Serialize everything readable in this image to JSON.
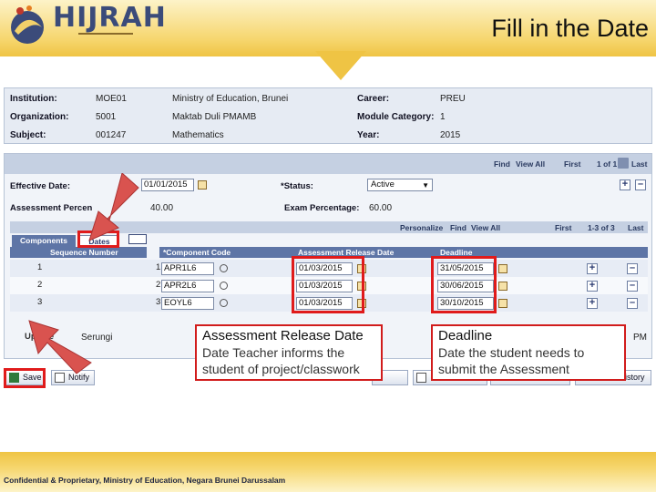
{
  "header": {
    "brand": "HIJRAH",
    "slide_title": "Fill in the Date"
  },
  "info": {
    "institution_label": "Institution:",
    "institution_code": "MOE01",
    "institution_name": "Ministry of Education, Brunei",
    "organization_label": "Organization:",
    "organization_code": "5001",
    "organization_name": "Maktab Duli PMAMB",
    "subject_label": "Subject:",
    "subject_code": "001247",
    "subject_name": "Mathematics",
    "career_label": "Career:",
    "career_value": "PREU",
    "module_category_label": "Module Category:",
    "module_category_value": "1",
    "year_label": "Year:",
    "year_value": "2015"
  },
  "panel": {
    "nav_find": "Find",
    "nav_view_all": "View All",
    "nav_first": "First",
    "nav_count": "1 of 1",
    "nav_last": "Last",
    "effective_date_label": "Effective Date:",
    "effective_date_value": "01/01/2015",
    "status_label": "*Status:",
    "status_value": "Active",
    "assessment_percent_label": "Assessment Percen",
    "assessment_percent_value": "40.00",
    "exam_percentage_label": "Exam Percentage:",
    "exam_percentage_value": "60.00",
    "grid_personalize": "Personalize",
    "grid_find": "Find",
    "grid_view_all": "View All",
    "grid_first": "First",
    "grid_count": "1-3 of 3",
    "grid_last": "Last",
    "tabs": [
      {
        "label": "Components"
      },
      {
        "label": "Dates"
      }
    ],
    "columns": {
      "sequence": "Sequence Number",
      "component": "*Component Code",
      "release": "Assessment Release Date",
      "deadline": "Deadline"
    },
    "rows": [
      {
        "row": "1",
        "seq": "1",
        "code": "APR1L6",
        "release": "01/03/2015",
        "deadline": "31/05/2015"
      },
      {
        "row": "2",
        "seq": "2",
        "code": "APR2L6",
        "release": "01/03/2015",
        "deadline": "30/06/2015"
      },
      {
        "row": "3",
        "seq": "3",
        "code": "EOYL6",
        "release": "01/03/2015",
        "deadline": "30/10/2015"
      }
    ],
    "updated_label": "Update",
    "updated_value": "Serungi",
    "pm_fragment": "PM"
  },
  "toolbar": {
    "save_label": "Save",
    "notify_label": "Notify",
    "history_label": "istory"
  },
  "callouts": {
    "release_title": "Assessment Release Date",
    "release_desc": "Date Teacher informs the student of project/classwork",
    "deadline_title": "Deadline",
    "deadline_desc": "Date the student needs to submit the Assessment"
  },
  "footer": {
    "text": "Confidential & Proprietary, Ministry of Education, Negara Brunei Darussalam"
  },
  "colors": {
    "highlight": "#e01b1b",
    "arrow": "#d9534f",
    "header_gold": "#efc444",
    "grid_header": "#5e75a6"
  }
}
